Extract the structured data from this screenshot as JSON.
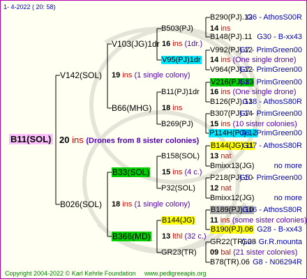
{
  "header": {
    "date": "1- 4-2022 ( 20: 58)"
  },
  "footer": {
    "copyright": "Copyright 2004-2022 © Karl Kehrle Foundation",
    "site": "www.pedigreeapis.org"
  },
  "subject": {
    "label": "B11(SOL)",
    "generation": "20",
    "ins": "ins",
    "note": "(Drones from 8 sister colonies)"
  },
  "gen1": [
    {
      "label": "V142(SOL)",
      "gen": "19",
      "ins": "ins",
      "note": "(1 single colony)"
    },
    {
      "label": "B026(SOL)",
      "gen": "18",
      "ins": "ins",
      "note": "(1 single colony)"
    }
  ],
  "gen2": [
    {
      "label": "V103(JG)1dr",
      "gen": "16",
      "ins": "ins",
      "note": "(1dr.)"
    },
    {
      "label": "B66(MHG)",
      "gen": "18",
      "ins": "ins",
      "note": ""
    },
    {
      "label": "B33(SOL)",
      "gen": "15",
      "ins": "ins",
      "note": "(4 c.)"
    },
    {
      "label": "B366(MD)",
      "gen": "13",
      "ins": "lthl",
      "note": "(32 c.)"
    }
  ],
  "gen3": [
    {
      "label": "B503(PJ)",
      "gen": "14",
      "ins": "ins",
      "note": ""
    },
    {
      "label": "V95(PJ)1dr",
      "gen": "14",
      "ins": "ins",
      "note": "(One single drone)"
    },
    {
      "label": "B11(PJ)1dr",
      "gen": "16",
      "ins": "ins",
      "note": "(One single drone)"
    },
    {
      "label": "B269(PJ)",
      "gen": "15",
      "ins": "ins",
      "note": "(10 sister colonies)"
    },
    {
      "label": "B158(SOL)",
      "gen": "13",
      "ins": "nat",
      "note": ""
    },
    {
      "label": "P32(SOL)",
      "gen": "12",
      "ins": "nat",
      "note": ""
    },
    {
      "label": "B144(JG)",
      "gen": "11",
      "ins": "ins",
      "note": "(some sister colonies)"
    },
    {
      "label": "GR23(TR)",
      "gen": "09",
      "ins": "bal",
      "note": "(21 sister colonies)"
    }
  ],
  "gen4": [
    {
      "label": "B290(PJ).12",
      "info": "G6 - AthosS00R"
    },
    {
      "label": "B148(PJ).11",
      "info": "G30 - B-xx43"
    },
    {
      "label": "V992(PJ).12",
      "info": "G7 - PrimGreen00"
    },
    {
      "label": "V964(PJ).12",
      "info": "G7 - PrimGreen00"
    },
    {
      "label": "V216(PJ).13",
      "info": "G8 - PrimGreen00"
    },
    {
      "label": "B126(PJ).13",
      "info": "G18 - AthosS80R"
    },
    {
      "label": "B307(PJ).14",
      "info": "G7 - PrimGreen00"
    },
    {
      "label": "P114H(PJ).12",
      "info": "G6 - PrimGreen00"
    },
    {
      "label": "B144(JG).11",
      "info": "G17 - AthosS80R"
    },
    {
      "label": "Bmixx13(JG)",
      "info": "no more"
    },
    {
      "label": "P218(PJ).10",
      "info": "G5 - PrimGreen00"
    },
    {
      "label": "Bmixx12(JG)",
      "info": "no more"
    },
    {
      "label": "B189(PJ).10",
      "info": "G16 - AthosS80R"
    },
    {
      "label": "B190(PJ).06",
      "info": "G28 - B-xx43"
    },
    {
      "label": "GR22(TR).08",
      "info": "G2 - Gr.R.mounta"
    },
    {
      "label": "B78(TR).06",
      "info": "G8 - N06294R"
    }
  ],
  "colors": {
    "border": "#b000b0",
    "background": "#fffff2",
    "highlight_subject": "#ffc0ff",
    "highlight_green": "#00d000",
    "highlight_cyan": "#00e8ff",
    "highlight_yellow": "#ffff00",
    "highlight_gray": "#b0b0b0",
    "generation_red": "#d00000",
    "info_blue": "#0000c0",
    "note_purple": "#5000b0"
  }
}
